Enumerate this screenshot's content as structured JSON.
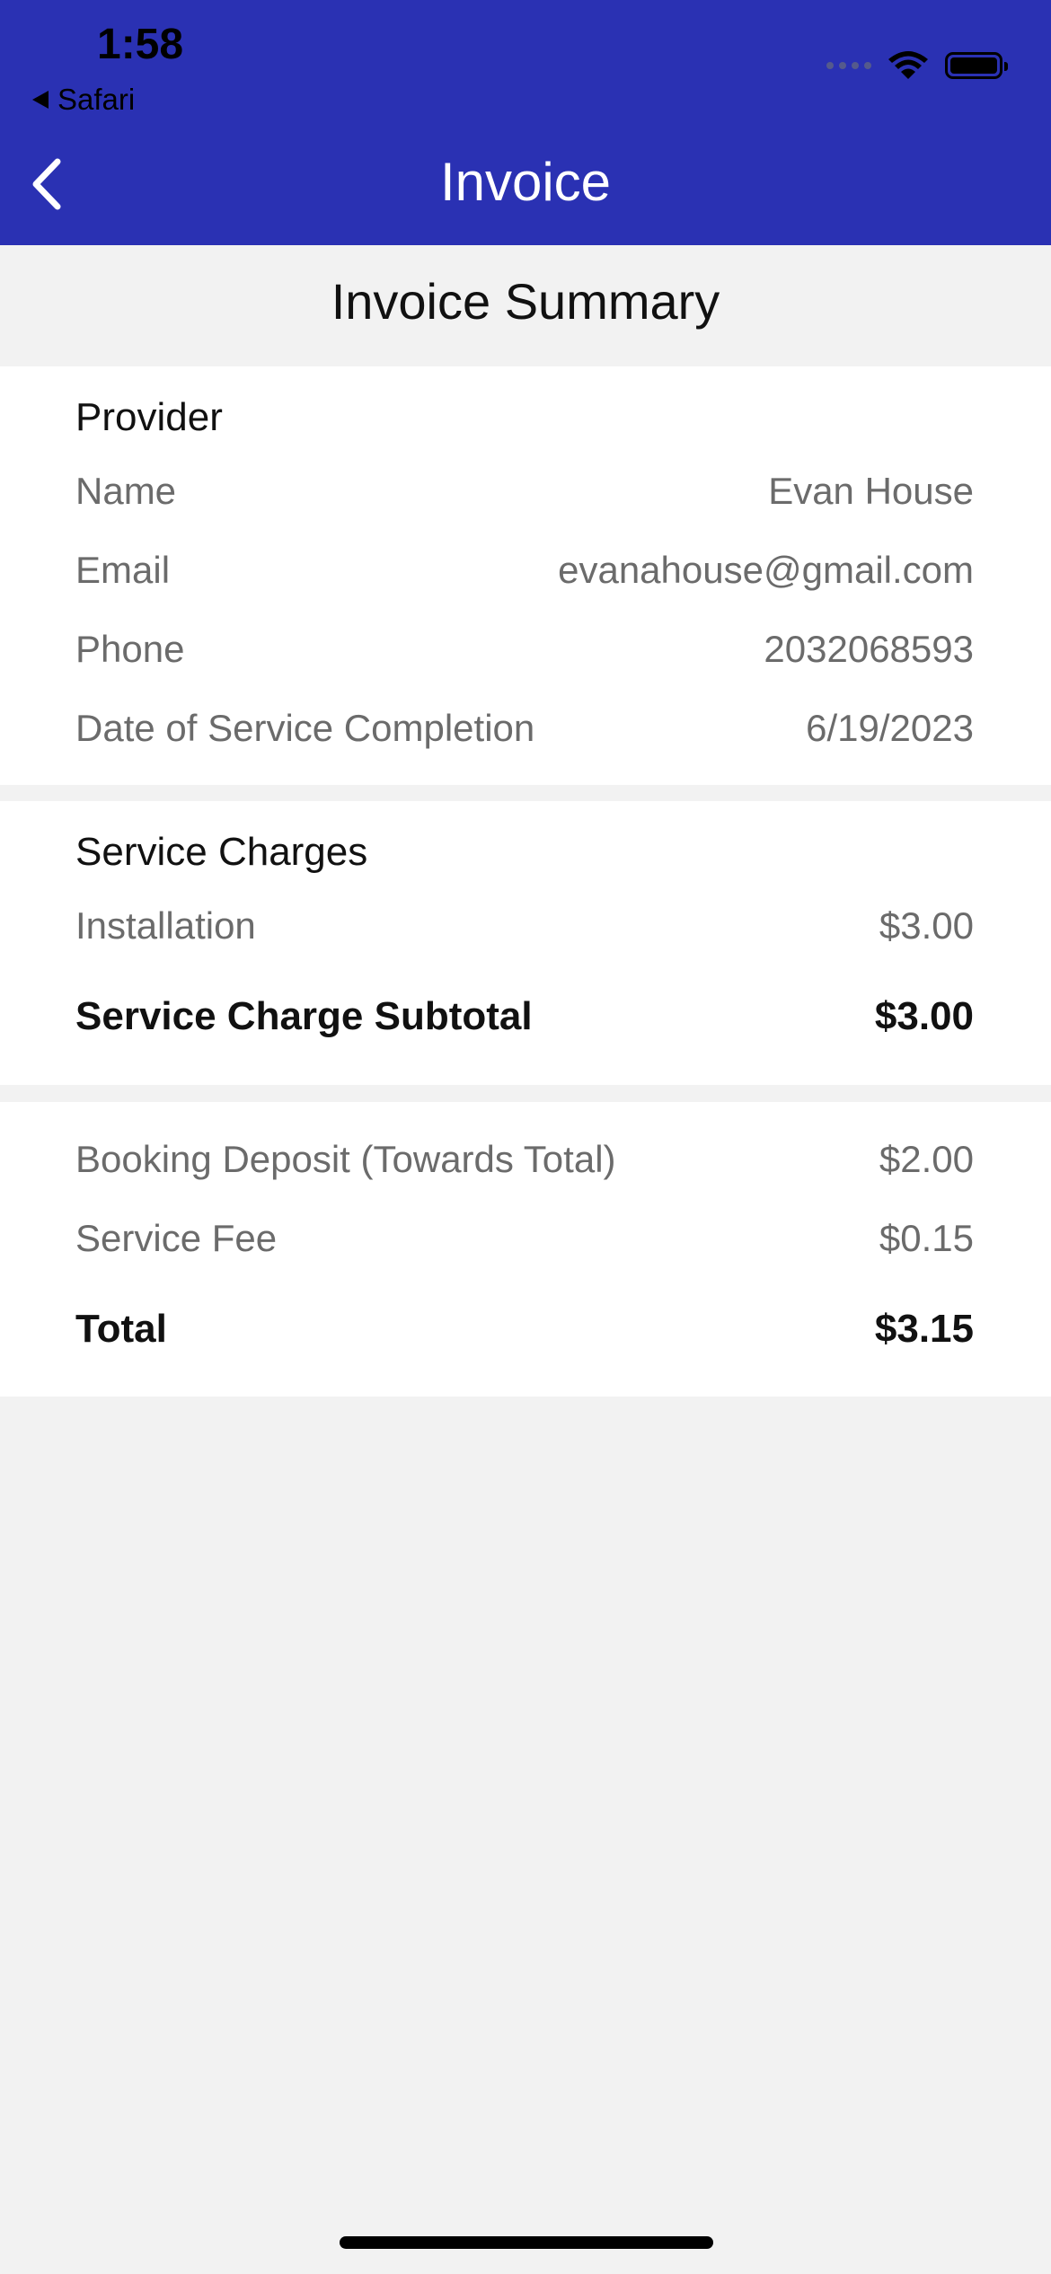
{
  "status_bar": {
    "time": "1:58",
    "back_app_label": "Safari",
    "icons": [
      "cellular-signal-icon",
      "wifi-icon",
      "battery-icon"
    ]
  },
  "nav": {
    "title": "Invoice",
    "back_icon": "chevron-left-icon"
  },
  "summary_title": "Invoice Summary",
  "provider": {
    "heading": "Provider",
    "rows": [
      {
        "label": "Name",
        "value": "Evan House"
      },
      {
        "label": "Email",
        "value": "evanahouse@gmail.com"
      },
      {
        "label": "Phone",
        "value": "2032068593"
      },
      {
        "label": "Date of Service Completion",
        "value": "6/19/2023"
      }
    ]
  },
  "service_charges": {
    "heading": "Service Charges",
    "items": [
      {
        "label": "Installation",
        "value": "$3.00"
      }
    ],
    "subtotal": {
      "label": "Service Charge Subtotal",
      "value": "$3.00"
    }
  },
  "totals": {
    "rows": [
      {
        "label": "Booking Deposit (Towards Total)",
        "value": "$2.00"
      },
      {
        "label": "Service Fee",
        "value": "$0.15"
      }
    ],
    "total": {
      "label": "Total",
      "value": "$3.15"
    }
  },
  "colors": {
    "header_bg": "#2a31b3",
    "page_bg": "#f2f2f2",
    "card_bg": "#ffffff",
    "muted_text": "#6b6b6b"
  }
}
